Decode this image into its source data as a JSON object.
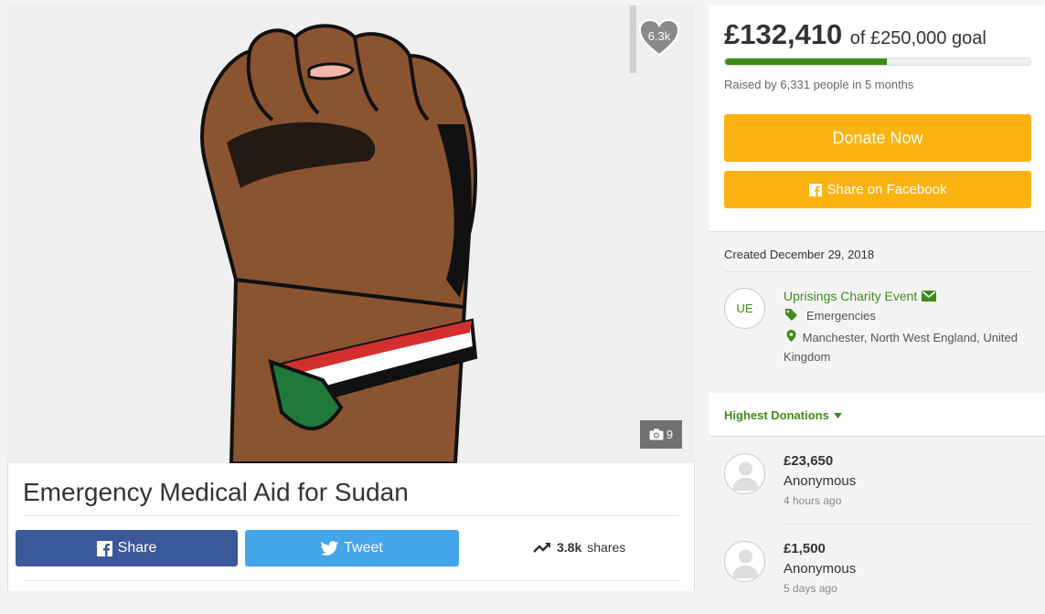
{
  "campaign": {
    "title": "Emergency Medical Aid for Sudan",
    "hearts": "6.3k",
    "photo_count": "9"
  },
  "social": {
    "share_label": "Share",
    "tweet_label": "Tweet",
    "shares_count": "3.8k",
    "shares_label": "shares"
  },
  "funding": {
    "raised": "£132,410",
    "goal_text": "of £250,000 goal",
    "progress_fraction": 0.5296,
    "raised_by": "Raised by 6,331 people in 5 months",
    "donate_label": "Donate Now",
    "share_fb_label": "Share on Facebook"
  },
  "meta": {
    "created": "Created December 29, 2018",
    "organizer_initials": "UE",
    "organizer": "Uprisings Charity Event",
    "category": "Emergencies",
    "location": "Manchester, North West England, United Kingdom"
  },
  "donations": {
    "header": "Highest Donations",
    "items": [
      {
        "amount": "£23,650",
        "name": "Anonymous",
        "when": "4 hours ago"
      },
      {
        "amount": "£1,500",
        "name": "Anonymous",
        "when": "5 days ago"
      }
    ]
  },
  "colors": {
    "accent_green": "#3f8b1a",
    "donate_yellow": "#fbb311",
    "facebook_blue": "#3b5998",
    "twitter_blue": "#45a5ea"
  }
}
